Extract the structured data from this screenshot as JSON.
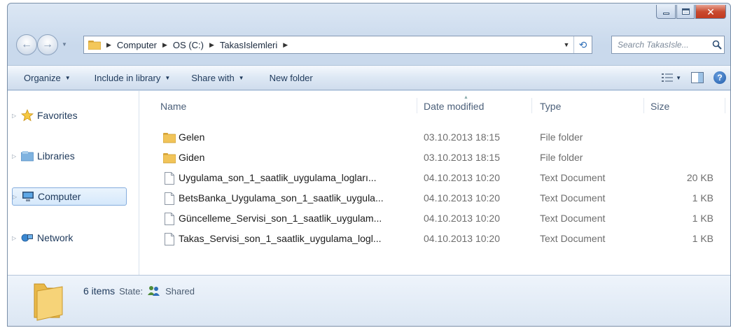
{
  "breadcrumb": [
    "Computer",
    "OS (C:)",
    "TakasIslemleri"
  ],
  "search": {
    "placeholder": "Search TakasIsle..."
  },
  "toolbar": {
    "organize": "Organize",
    "include": "Include in library",
    "share": "Share with",
    "new_folder": "New folder"
  },
  "nav": {
    "favorites": "Favorites",
    "libraries": "Libraries",
    "computer": "Computer",
    "network": "Network"
  },
  "columns": {
    "name": "Name",
    "date": "Date modified",
    "type": "Type",
    "size": "Size"
  },
  "files": [
    {
      "name": "Gelen",
      "date": "03.10.2013 18:15",
      "type": "File folder",
      "size": "",
      "icon": "folder-icon"
    },
    {
      "name": "Giden",
      "date": "03.10.2013 18:15",
      "type": "File folder",
      "size": "",
      "icon": "folder-icon"
    },
    {
      "name": "Uygulama_son_1_saatlik_uygulama_logları...",
      "date": "04.10.2013 10:20",
      "type": "Text Document",
      "size": "20 KB",
      "icon": "text-document-icon"
    },
    {
      "name": "BetsBanka_Uygulama_son_1_saatlik_uygula...",
      "date": "04.10.2013 10:20",
      "type": "Text Document",
      "size": "1 KB",
      "icon": "text-document-icon"
    },
    {
      "name": "Güncelleme_Servisi_son_1_saatlik_uygulam...",
      "date": "04.10.2013 10:20",
      "type": "Text Document",
      "size": "1 KB",
      "icon": "text-document-icon"
    },
    {
      "name": "Takas_Servisi_son_1_saatlik_uygulama_logl...",
      "date": "04.10.2013 10:20",
      "type": "Text Document",
      "size": "1 KB",
      "icon": "text-document-icon"
    }
  ],
  "details": {
    "count": "6 items",
    "state_label": "State:",
    "state_value": "Shared"
  }
}
